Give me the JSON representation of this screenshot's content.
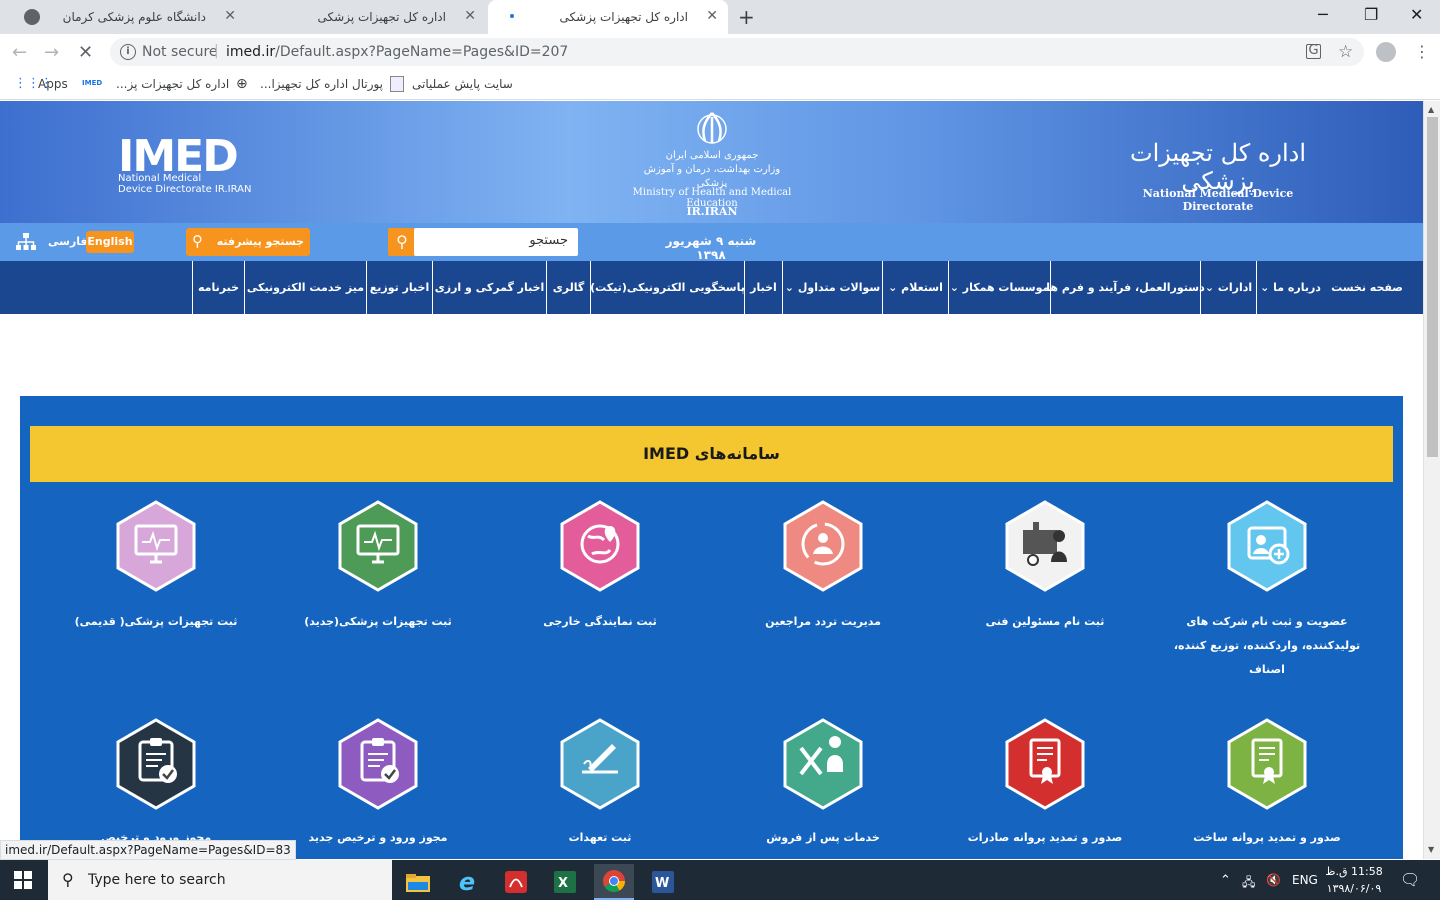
{
  "browser": {
    "tabs": [
      {
        "title": "دانشگاه علوم پزشکی کرمان"
      },
      {
        "title": "اداره کل تجهیزات پزشکی"
      },
      {
        "title": "اداره کل تجهیزات پزشکی"
      }
    ],
    "new_tab": "+",
    "window": {
      "minimize": "─",
      "restore": "❐",
      "close": "✕"
    },
    "nav": {
      "back": "←",
      "forward": "→",
      "stop": "✕"
    },
    "omnibox": {
      "security": "Not secure",
      "domain": "imed.ir",
      "path": "/Default.aspx?PageName=Pages&ID=207"
    },
    "toolbar_icons": {
      "translate": "translate-icon",
      "star": "☆",
      "menu": "⋮"
    },
    "bookmarks": [
      {
        "label": "Apps"
      },
      {
        "label": "اداره کل تجهیزات پز..."
      },
      {
        "label": "پورتال اداره کل تجهیزا..."
      },
      {
        "label": "سایت پایش عملیاتی"
      }
    ],
    "status_url": "imed.ir/Default.aspx?PageName=Pages&ID=83"
  },
  "site": {
    "logo": {
      "text": "IMED",
      "sub1": "National Medical",
      "sub2": "Device Directorate IR.IRAN"
    },
    "emblem": {
      "fa1": "جمهوری اسلامی ایران",
      "fa2": "وزارت بهداشت، درمان و آموزش پزشکی",
      "en": "Ministry of Health and Medical Education",
      "country": "IR.IRAN"
    },
    "brand": {
      "fa": "اداره کل تجهیزات پزشکی",
      "en": "National Medical Device Directorate"
    },
    "search_placeholder": "جستجو",
    "advanced_search": "جستجو پیشرفته",
    "date": "شنبه ۹ شهریور ۱۳۹۸",
    "lang_en": "English",
    "lang_fa": "فارسی",
    "nav": [
      {
        "label": "صفحه نخست"
      },
      {
        "label": "درباره ما"
      },
      {
        "label": "ادارات"
      },
      {
        "label": "دستورالعمل، فرآیند و فرم ها"
      },
      {
        "label": "موسسات همکار"
      },
      {
        "label": "استعلام"
      },
      {
        "label": "سوالات متداول"
      },
      {
        "label": "اخبار"
      },
      {
        "label": "پاسخگویی الکترونیکی(تیکت)"
      },
      {
        "label": "گالری"
      },
      {
        "label": "اخبار گمرکی و ارزی"
      },
      {
        "label": "اخبار توزیع"
      },
      {
        "label": "میز خدمت الکترونیکی"
      },
      {
        "label": "خبرنامه"
      }
    ],
    "systems_title": "سامانه‌های IMED",
    "systems": [
      {
        "label": "عضویت و ثبت نام شرکت های تولیدکننده، واردکننده، توزیع کننده، اصناف",
        "icon": "id-card-plus-icon",
        "color": "#63c6ef"
      },
      {
        "label": "ثبت نام مسئولین فنی",
        "icon": "technician-icon",
        "color": "#f2f2f2"
      },
      {
        "label": "مدیریت تردد مراجعین",
        "icon": "visitors-icon",
        "color": "#ef8a82"
      },
      {
        "label": "ثبت نمایندگی خارجی",
        "icon": "globe-pin-icon",
        "color": "#e35d9a"
      },
      {
        "label": "ثبت تجهیزات پزشکی(جدید)",
        "icon": "monitor-icon",
        "color": "#4e9a57"
      },
      {
        "label": "ثبت تجهیزات پزشکی( قدیمی)",
        "icon": "monitor-icon",
        "color": "#d6a7d8"
      },
      {
        "label": "صدور و تمدید پروانه ساخت",
        "icon": "certificate-icon",
        "color": "#7cb342"
      },
      {
        "label": "صدور و تمدید پروانه صادرات",
        "icon": "certificate-icon",
        "color": "#d32f2f"
      },
      {
        "label": "خدمات پس از فروش",
        "icon": "service-icon",
        "color": "#43a98a"
      },
      {
        "label": "ثبت تعهدات",
        "icon": "signature-icon",
        "color": "#4aa3c9"
      },
      {
        "label": "مجوز ورود و ترخیص جدید",
        "icon": "clipboard-check-icon",
        "color": "#8e5bc0"
      },
      {
        "label": "مجوز ورود و ترخیص",
        "icon": "clipboard-check-icon",
        "color": "#263544"
      }
    ]
  },
  "taskbar": {
    "search_placeholder": "Type here to search",
    "lang": "ENG",
    "time": "11:58 ق.ظ",
    "date": "۱۳۹۸/۰۶/۰۹"
  }
}
